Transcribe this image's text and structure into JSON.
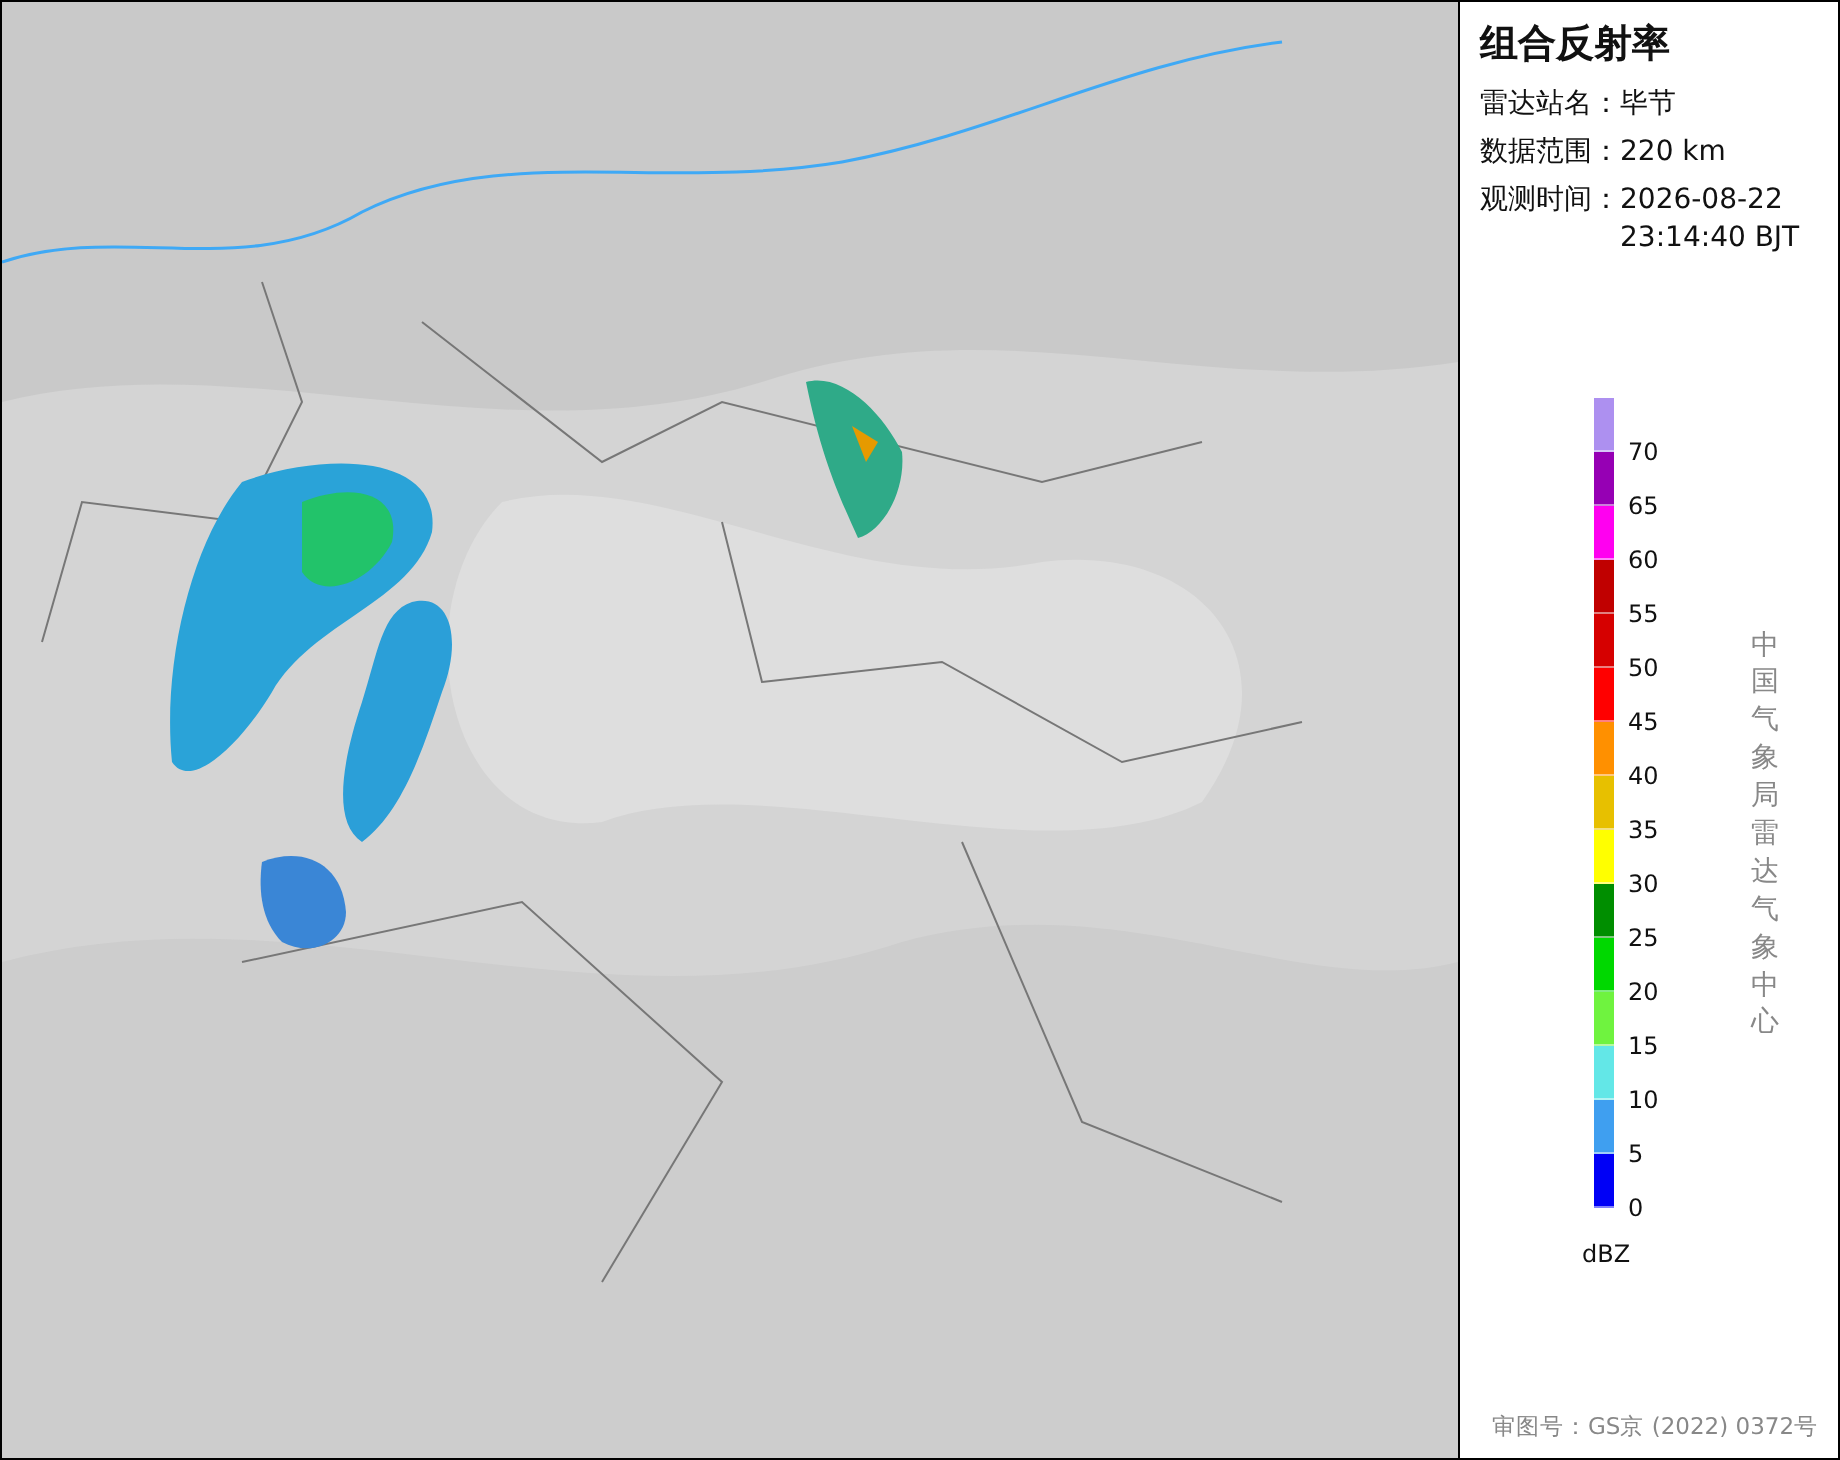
{
  "panel": {
    "title": "组合反射率",
    "info": [
      {
        "label": "雷达站名：",
        "value": "毕节"
      },
      {
        "label": "数据范围：",
        "value": "220 km"
      },
      {
        "label": "观测时间：",
        "value": "2026-08-22\n23:14:40 BJT"
      }
    ],
    "legend": {
      "unit": "dBZ",
      "entries": [
        {
          "color": "#ad90f0",
          "label": "70"
        },
        {
          "color": "#9600b4",
          "label": "65"
        },
        {
          "color": "#ff00f0",
          "label": "60"
        },
        {
          "color": "#c00000",
          "label": "55"
        },
        {
          "color": "#d60000",
          "label": "50"
        },
        {
          "color": "#ff0000",
          "label": "45"
        },
        {
          "color": "#ff9000",
          "label": "40"
        },
        {
          "color": "#e7c000",
          "label": "35"
        },
        {
          "color": "#ffff00",
          "label": "30"
        },
        {
          "color": "#008e00",
          "label": "25"
        },
        {
          "color": "#00d800",
          "label": "20"
        },
        {
          "color": "#6ff33f",
          "label": "15"
        },
        {
          "color": "#63e7e7",
          "label": "10"
        },
        {
          "color": "#3f9ff0",
          "label": "5"
        },
        {
          "color": "#0000f6",
          "label": "0"
        }
      ]
    },
    "credit": "中国气象局雷达气象中心",
    "approval": "审图号：GS京 (2022) 0372号"
  }
}
